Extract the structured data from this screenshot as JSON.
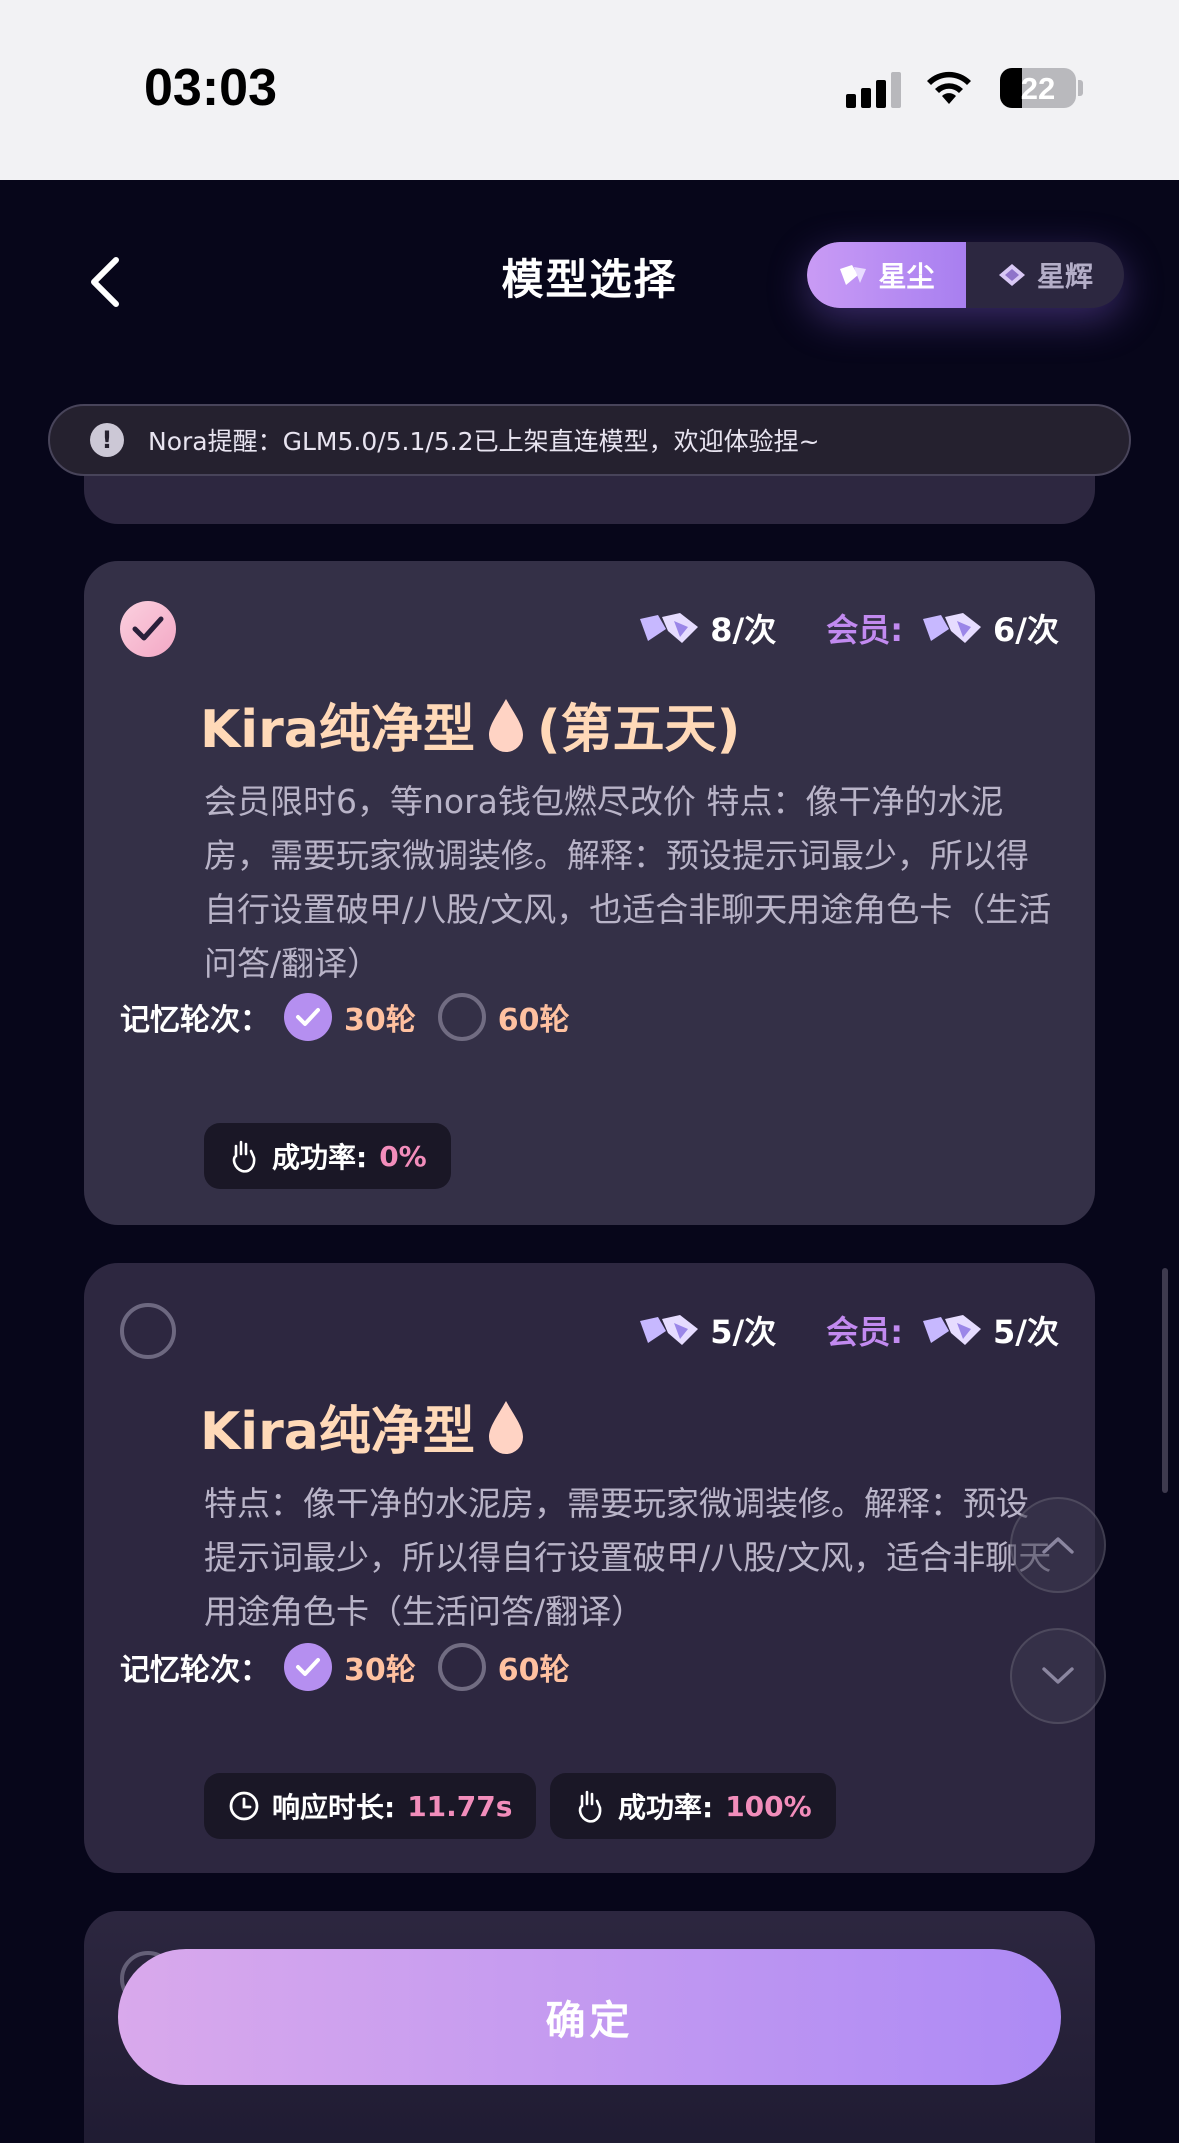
{
  "status_bar": {
    "time": "03:03",
    "battery": "22"
  },
  "header": {
    "title": "模型选择",
    "segments": [
      {
        "label": "星尘",
        "active": true
      },
      {
        "label": "星辉",
        "active": false
      }
    ]
  },
  "notice": {
    "text": "Nora提醒：GLM5.0/5.1/5.2已上架直连模型，欢迎体验捏~"
  },
  "cards": [
    {
      "selected": true,
      "price": "8/次",
      "member_label": "会员:",
      "member_price": "6/次",
      "title": "Kira纯净型",
      "title_suffix": "(第五天)",
      "description": "会员限时6，等nora钱包燃尽改价 特点：像干净的水泥房，需要玩家微调装修。解释：预设提示词最少，所以得自行设置破甲/八股/文风，也适合非聊天用途角色卡（生活问答/翻译）",
      "memory_label": "记忆轮次：",
      "memory_options": [
        {
          "label": "30轮",
          "selected": true
        },
        {
          "label": "60轮",
          "selected": false
        }
      ],
      "stats": [
        {
          "key": "成功率:",
          "value": "0%"
        }
      ]
    },
    {
      "selected": false,
      "price": "5/次",
      "member_label": "会员:",
      "member_price": "5/次",
      "title": "Kira纯净型",
      "title_suffix": "",
      "description": "特点：像干净的水泥房，需要玩家微调装修。解释：预设提示词最少，所以得自行设置破甲/八股/文风，适合非聊天用途角色卡（生活问答/翻译）",
      "memory_label": "记忆轮次：",
      "memory_options": [
        {
          "label": "30轮",
          "selected": true
        },
        {
          "label": "60轮",
          "selected": false
        }
      ],
      "stats": [
        {
          "key": "响应时长:",
          "value": "11.77s"
        },
        {
          "key": "成功率:",
          "value": "100%"
        }
      ]
    }
  ],
  "confirm_label": "确定",
  "colors": {
    "accent": "#b58ff0",
    "title": "#ffd9b8",
    "value_pink": "#f28dbb",
    "background": "#07061a"
  }
}
